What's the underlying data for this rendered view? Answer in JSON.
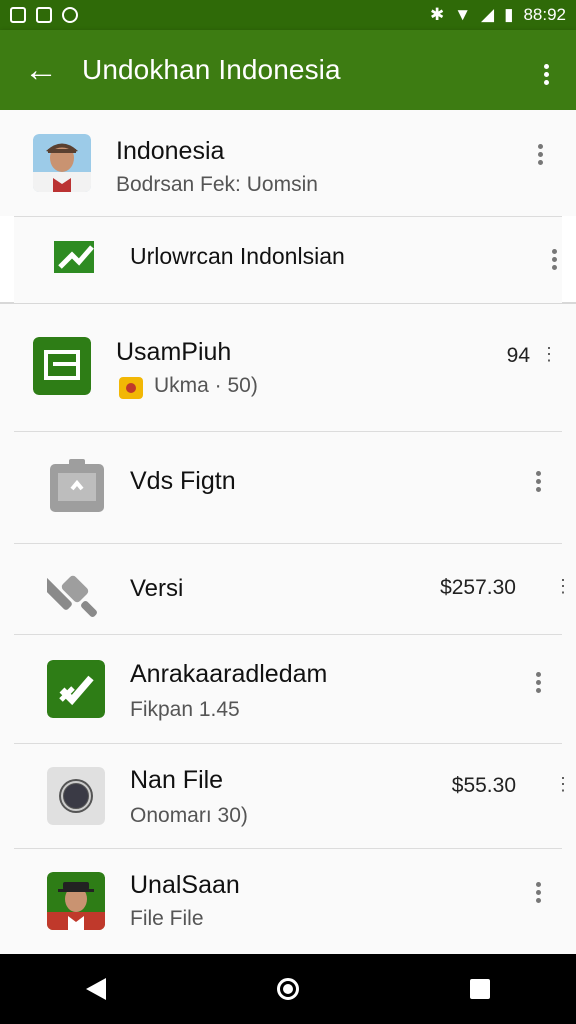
{
  "status": {
    "time": "88:92",
    "bluetooth": "bluetooth-icon",
    "wifi": "wifi-icon",
    "battery": "battery-icon"
  },
  "appbar": {
    "title": "Undokhan Indonesia",
    "back_icon": "←"
  },
  "header": {
    "items": [
      {
        "name": "Indonesia",
        "subtitle": "Bodrsan Fek: Uomsin"
      },
      {
        "name": "Urlowrcan Indonlsian"
      }
    ]
  },
  "items": [
    {
      "name": "UsamPiuh",
      "subtitle": "Ukma · 50)",
      "price": "94"
    },
    {
      "name": "Vds Figtn"
    },
    {
      "name": "Versi",
      "price": "$257.30"
    },
    {
      "name": "Anrakaaradledam",
      "subtitle": "Fikpan 1.45"
    },
    {
      "name": "Nan File",
      "subtitle": "Onomarı 30)",
      "price": "$55.30"
    },
    {
      "name": "UnalSaan",
      "subtitle": "File File"
    }
  ],
  "colors": {
    "appbar": "#3d7c12",
    "statusbar": "#2f6a08",
    "accent": "#2e7d16"
  }
}
